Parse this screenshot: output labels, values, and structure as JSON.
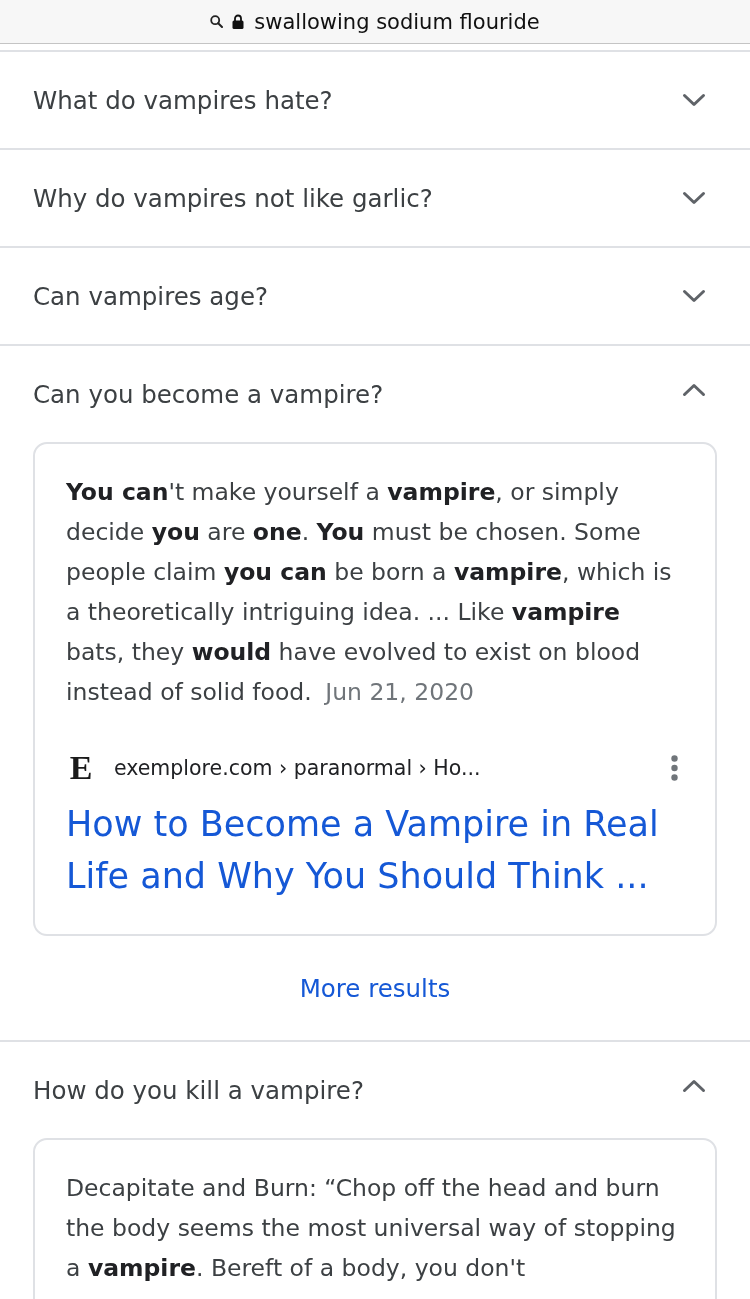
{
  "address_bar": {
    "query": "swallowing sodium flouride"
  },
  "questions": [
    {
      "question": "What do vampires hate?",
      "expanded": false
    },
    {
      "question": "Why do vampires not like garlic?",
      "expanded": false
    },
    {
      "question": "Can vampires age?",
      "expanded": false
    },
    {
      "question": "Can you become a vampire?",
      "expanded": true,
      "answer": {
        "snippet": "**You can**'t make yourself a **vampire**, or simply decide **you** are **one**. **You** must be chosen. Some people claim **you can** be born a **vampire**, which is a theoretically intriguing idea. ... Like **vampire** bats, they **would** have evolved to exist on blood instead of solid food.",
        "date": "Jun 21, 2020",
        "source": {
          "favicon_letter": "E",
          "breadcrumb": "exemplore.com › paranormal › Ho...",
          "title": "How to Become a Vampire in Real Life and Why You Should Think ..."
        }
      },
      "more_results": "More results"
    },
    {
      "question": "How do you kill a vampire?",
      "expanded": true,
      "answer": {
        "snippet": "Decapitate and Burn: “Chop off the head and burn the body seems the most universal way of stopping a **vampire**. Bereft of a body, you don't"
      }
    }
  ]
}
